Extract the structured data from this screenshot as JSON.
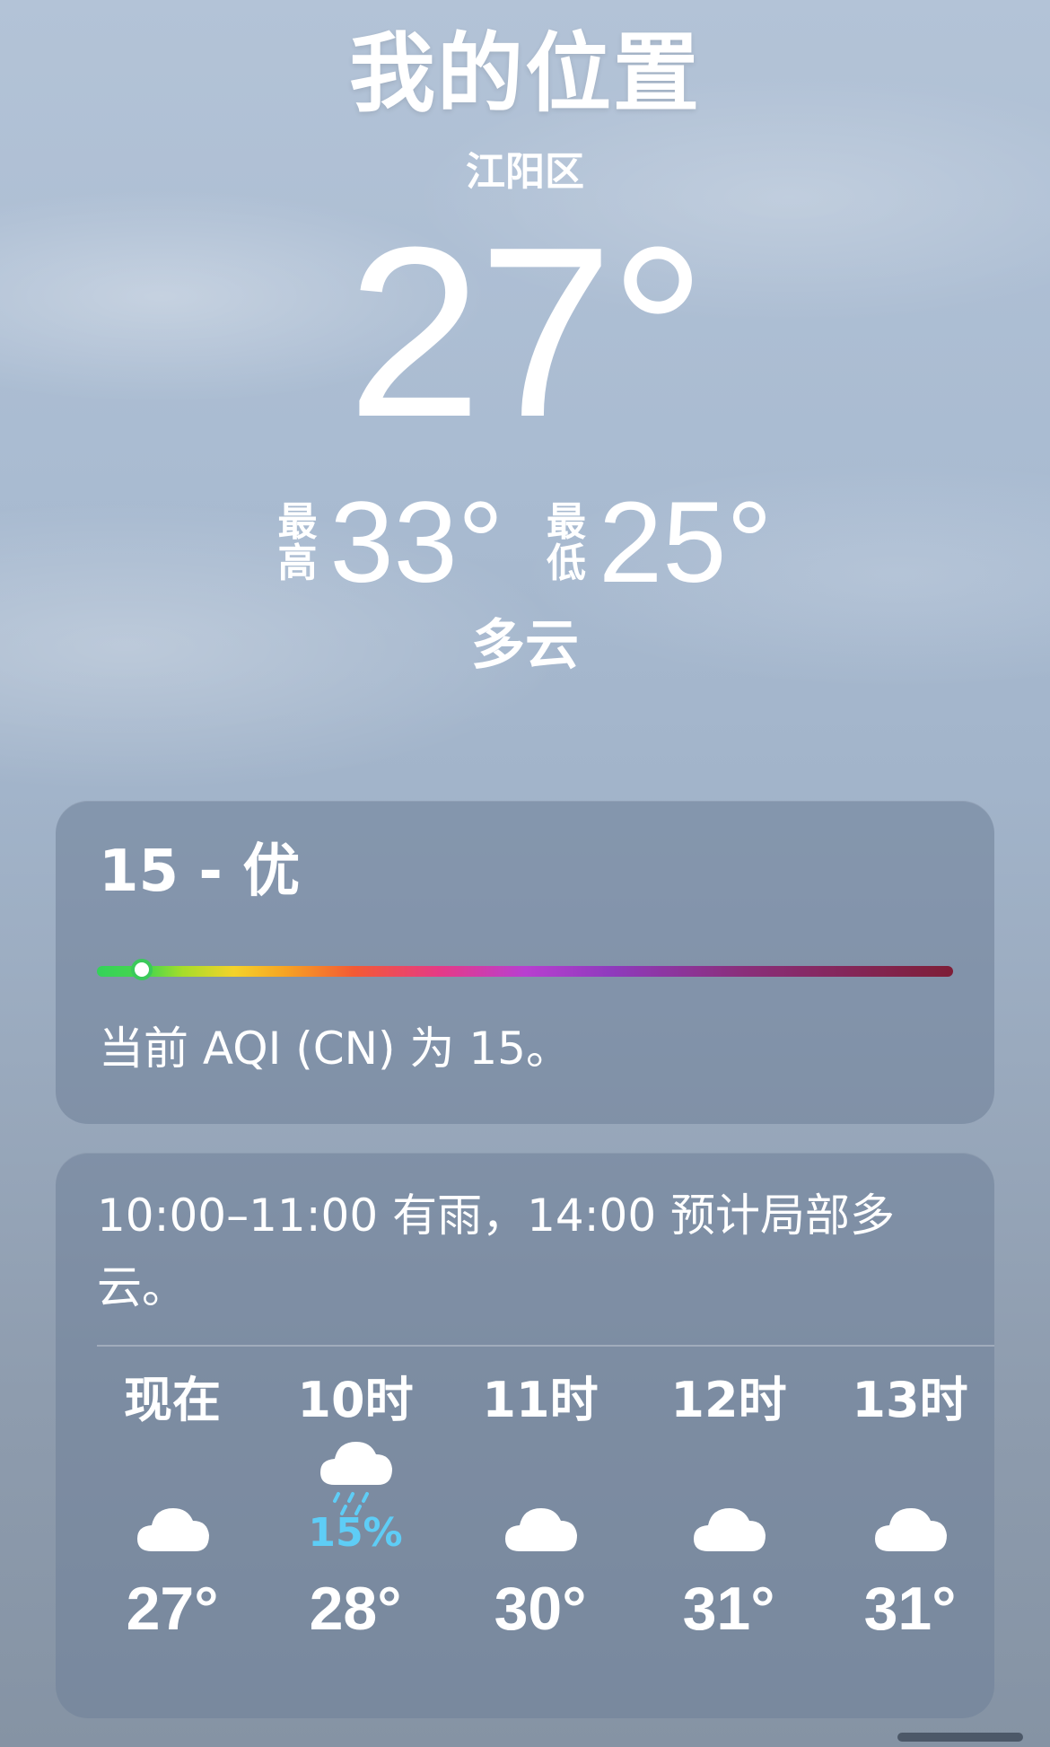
{
  "location": {
    "title": "我的位置",
    "district": "江阳区"
  },
  "current": {
    "temp": "27°",
    "high_label": "最高",
    "high": "33°",
    "low_label": "最低",
    "low": "25°",
    "condition": "多云"
  },
  "aqi": {
    "headline": "15 - 优",
    "value": 15,
    "description": "当前 AQI (CN) 为 15。"
  },
  "forecast": {
    "summary": "10:00–11:00 有雨，14:00 预计局部多云。",
    "hours": [
      {
        "time": "现在",
        "icon": "cloud-icon",
        "temp": "27°",
        "precip": ""
      },
      {
        "time": "10时",
        "icon": "cloud-rain-icon",
        "temp": "28°",
        "precip": "15%"
      },
      {
        "time": "11时",
        "icon": "cloud-icon",
        "temp": "30°",
        "precip": ""
      },
      {
        "time": "12时",
        "icon": "cloud-icon",
        "temp": "31°",
        "precip": ""
      },
      {
        "time": "13时",
        "icon": "cloud-icon",
        "temp": "31°",
        "precip": ""
      }
    ]
  },
  "colors": {
    "precip": "#5ecdf6",
    "aqi_good": "#34d25a"
  }
}
